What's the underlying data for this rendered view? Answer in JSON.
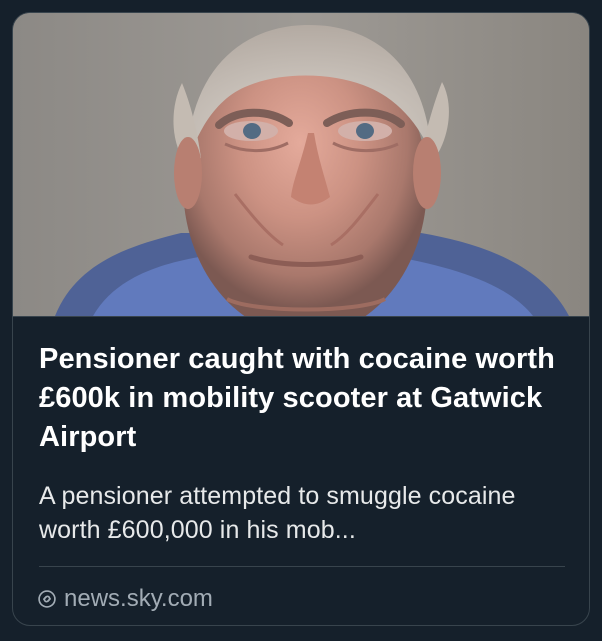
{
  "card": {
    "title": "Pensioner caught with cocaine worth £600k in mobility scooter at Gatwick Airport",
    "description": "A pensioner attempted to smuggle cocaine worth £600,000 in his mob...",
    "source": "news.sky.com"
  },
  "icons": {
    "source": "link-icon"
  },
  "colors": {
    "background": "#15202b",
    "border": "#38444d",
    "title": "#ffffff",
    "description": "#e7e9ea",
    "source": "#a2acb5"
  }
}
